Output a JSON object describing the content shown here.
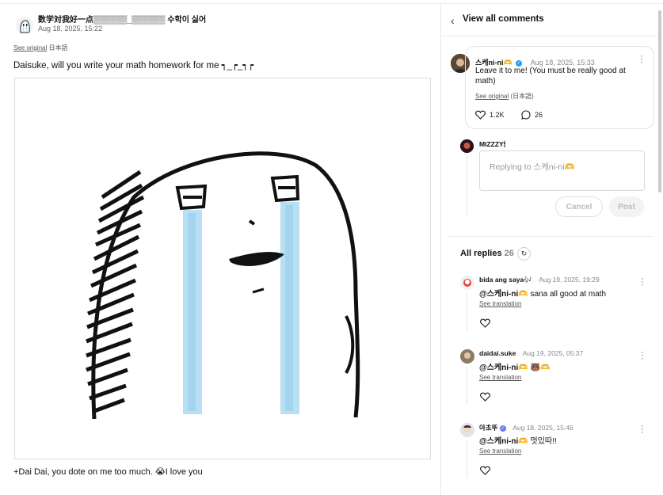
{
  "post": {
    "title": "数学対我好一点▒▒▒▒▒▒_▒▒▒▒▒▒ 수학이 싫어",
    "date": "Aug 18, 2025, 15:22",
    "see_original_link": "See original",
    "see_original_lang": "日本語",
    "text": "Daisuke, will you write your math homework for me ┑_┍_┑┍",
    "caption": "+Dai Dai, you dote on me too much. 😭I love you"
  },
  "panel": {
    "header_title": "View all comments",
    "main_comment": {
      "user": "스케ni-ni🫶",
      "date": "Aug 18, 2025, 15:33",
      "text": "Leave it to me! (You must be really good at math)",
      "see_original_link": "See original",
      "see_original_lang": "(日本語)",
      "likes": "1.2K",
      "replies": "26"
    },
    "reply_form": {
      "user": "MIZZZY🕯",
      "placeholder": "Replying to 스케ni-ni🫶",
      "cancel_label": "Cancel",
      "post_label": "Post"
    },
    "all_replies_label": "All replies",
    "all_replies_count": "26",
    "replies": [
      {
        "user": "bida ang saya🎶",
        "date": "Aug 19, 2025, 19:29",
        "mention": "@스케ni-ni🫶",
        "text": "sana all good at math",
        "translation_link": "See translation"
      },
      {
        "user": "daidai.suke",
        "date": "Aug 19, 2025, 05:37",
        "mention": "@스케ni-ni🫶",
        "text": "🐻🫶",
        "translation_link": "See translation"
      },
      {
        "user": "아초뚜",
        "date": "Aug 18, 2025, 15:46",
        "mention": "@스케ni-ni🫶",
        "text": "멋있따!!",
        "translation_link": "See translation"
      }
    ]
  },
  "colors": {
    "verified": "#1da1f2",
    "tears": "#b8e0f5"
  }
}
